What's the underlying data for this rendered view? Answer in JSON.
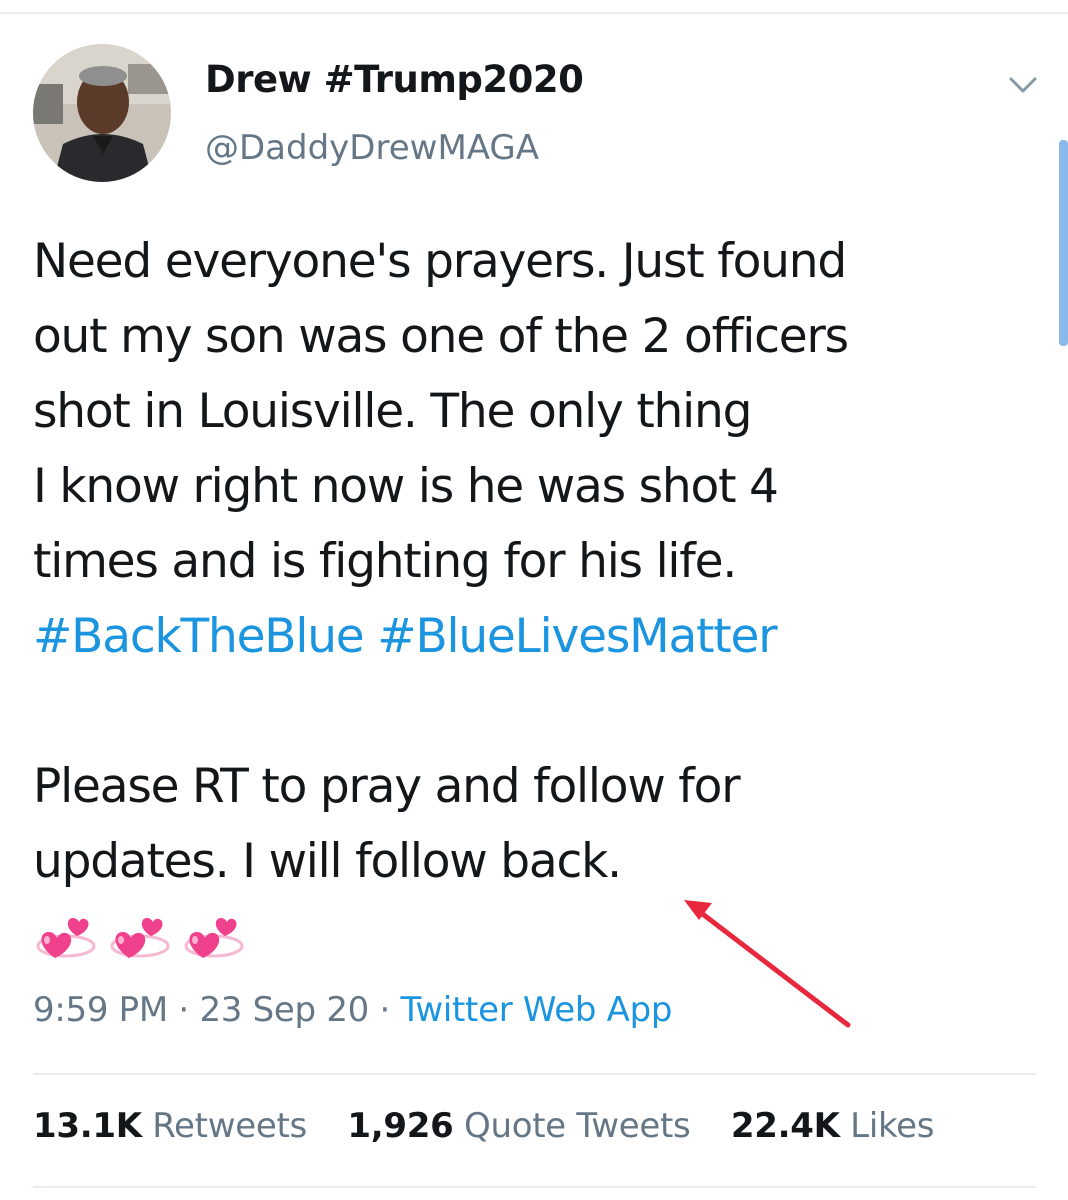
{
  "tweet": {
    "display_name": "Drew #Trump2020",
    "handle": "@DaddyDrewMAGA",
    "text_lines": [
      "Need everyone's prayers. Just found",
      "out my son was one of the 2 officers",
      "shot in Louisville. The only thing",
      "I know right now is he was shot 4",
      "times and is fighting for his life."
    ],
    "hashtags": [
      "#BackTheBlue",
      "#BlueLivesMatter"
    ],
    "text_lines_2": [
      "Please RT to pray and follow for",
      "updates. I will follow back."
    ],
    "emoji_icons": [
      "revolving-hearts-icon",
      "revolving-hearts-icon",
      "revolving-hearts-icon"
    ],
    "time": "9:59 PM",
    "date": "23 Sep 20",
    "separator": "·",
    "source": "Twitter Web App"
  },
  "stats": {
    "retweets_count": "13.1K",
    "retweets_label": "Retweets",
    "quotes_count": "1,926",
    "quotes_label": "Quote Tweets",
    "likes_count": "22.4K",
    "likes_label": "Likes"
  },
  "colors": {
    "hashtag": "#1b95e0",
    "secondary_text": "#657786",
    "annotation_arrow": "#e8283c"
  }
}
